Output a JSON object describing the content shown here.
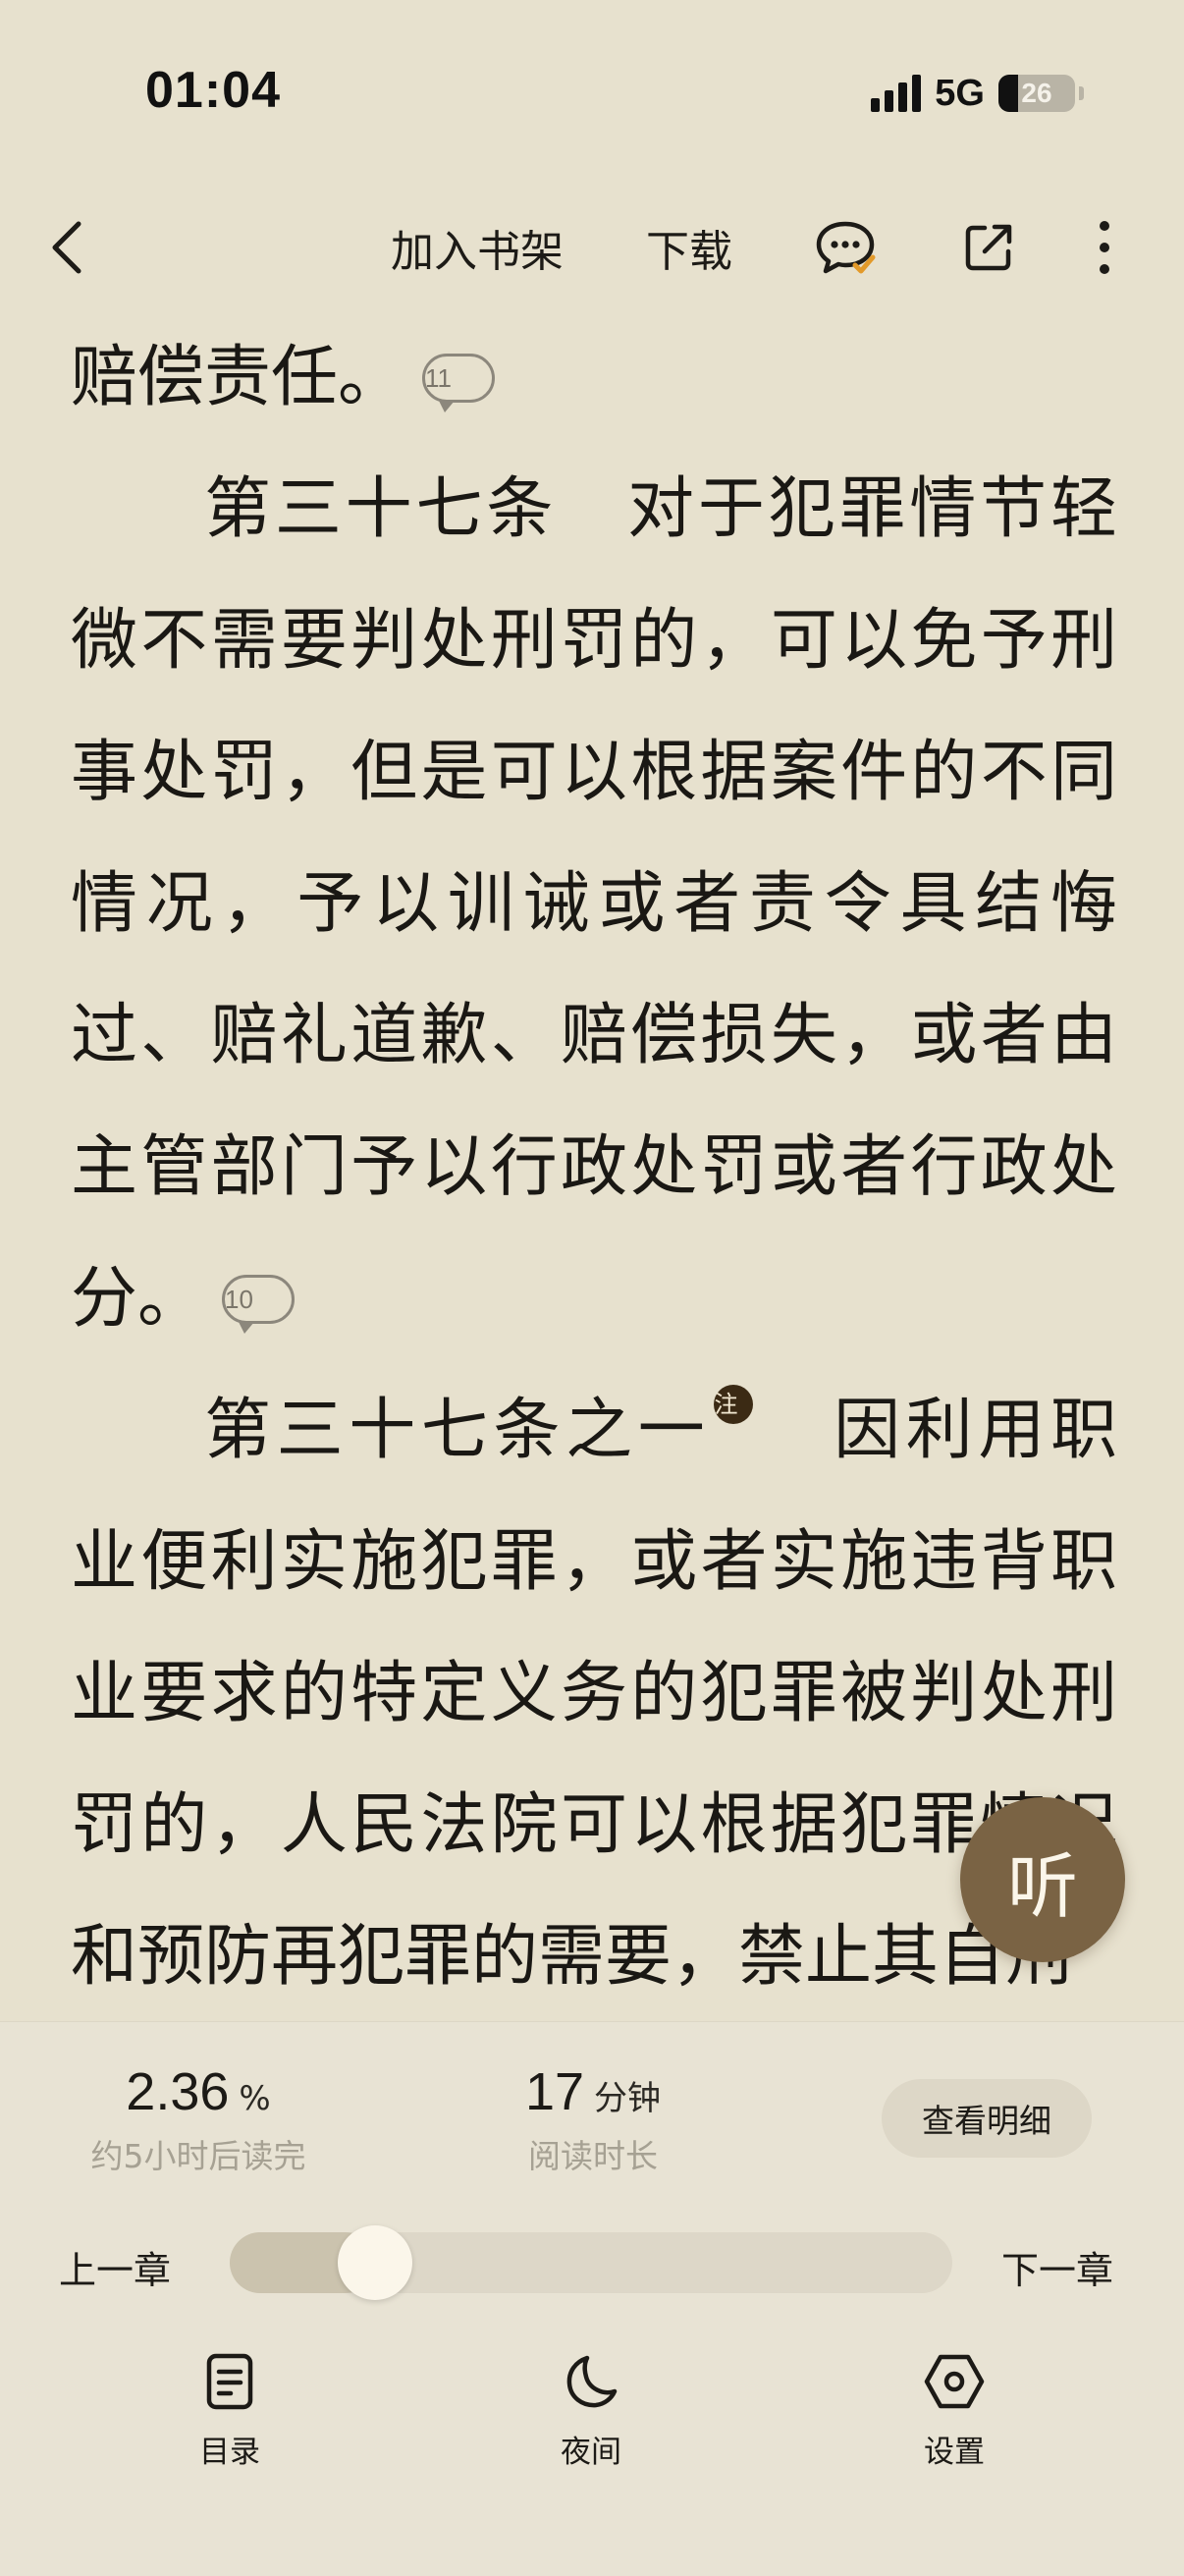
{
  "status_bar": {
    "time": "01:04",
    "network": "5G",
    "battery_level": "26",
    "battery_fraction": 0.26,
    "icons": [
      "signal-icon",
      "battery-icon"
    ]
  },
  "toolbar": {
    "add_to_shelf": "加入书架",
    "download": "下载",
    "icons": [
      "back-arrow-icon",
      "comment-check-icon",
      "share-icon",
      "more-vertical-icon"
    ]
  },
  "content": {
    "p0_text": "赔偿责任。",
    "p0_comments": "11",
    "p1_text": "第三十七条　对于犯罪情节轻微不需要判处刑罚的，可以免予刑事处罚，但是可以根据案件的不同情况，予以训诫或者责令具结悔过、赔礼道歉、赔偿损失，或者由主管部门予以行政处罚或者行政处分。",
    "p1_comments": "10",
    "p2_title": "第三十七条之一",
    "p2_note_mark": "注",
    "p2_text": "因利用职业便利实施犯罪，或者实施违背职业要求的特定义务的犯罪被判处刑罚的，人民法院可以根据犯罪情况和预防再犯罪的需要，禁止其自刑"
  },
  "listen_button": "听",
  "bottom_panel": {
    "progress_value": "2.36",
    "progress_unit": "%",
    "progress_sub": "约5小时后读完",
    "time_value": "17",
    "time_unit": "分钟",
    "time_sub": "阅读时长",
    "detail_button": "查看明细",
    "prev_chapter": "上一章",
    "next_chapter": "下一章",
    "slider_position": 0.15,
    "nav": {
      "toc": "目录",
      "night": "夜间",
      "settings": "设置"
    },
    "nav_icons": [
      "toc-icon",
      "moon-icon",
      "settings-hexagon-icon"
    ]
  }
}
